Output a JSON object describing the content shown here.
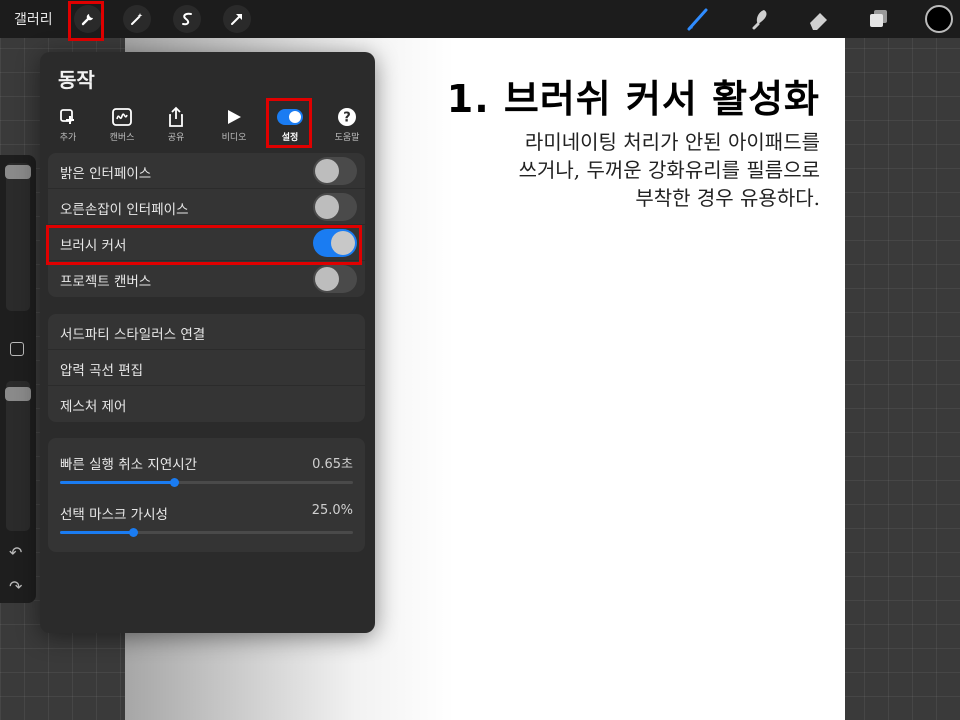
{
  "topbar": {
    "gallery_label": "갤러리"
  },
  "canvas": {
    "title": "1. 브러쉬 커서 활성화",
    "desc_lines": [
      "라미네이팅 처리가 안된 아이패드를",
      "쓰거나, 두꺼운 강화유리를 필름으로",
      "부착한 경우 유용하다."
    ]
  },
  "panel": {
    "title": "동작",
    "tabs": [
      {
        "label": "추가",
        "icon": "add-icon"
      },
      {
        "label": "캔버스",
        "icon": "canvas-icon"
      },
      {
        "label": "공유",
        "icon": "share-icon"
      },
      {
        "label": "비디오",
        "icon": "video-icon"
      },
      {
        "label": "설정",
        "icon": "toggle-icon"
      },
      {
        "label": "도움말",
        "icon": "help-icon"
      }
    ],
    "toggles": [
      {
        "label": "밝은 인터페이스",
        "on": false
      },
      {
        "label": "오른손잡이 인터페이스",
        "on": false
      },
      {
        "label": "브러시 커서",
        "on": true
      },
      {
        "label": "프로젝트 캔버스",
        "on": false
      }
    ],
    "links": [
      {
        "label": "서드파티 스타일러스 연결"
      },
      {
        "label": "압력 곡선 편집"
      },
      {
        "label": "제스처 제어"
      }
    ],
    "sliders": [
      {
        "label": "빠른 실행 취소 지연시간",
        "value_text": "0.65초",
        "fraction": 0.39
      },
      {
        "label": "선택 마스크 가시성",
        "value_text": "25.0%",
        "fraction": 0.25
      }
    ]
  },
  "colors": {
    "accent": "#1a7cf2",
    "highlight": "#e00000",
    "current_color": "#000000"
  }
}
